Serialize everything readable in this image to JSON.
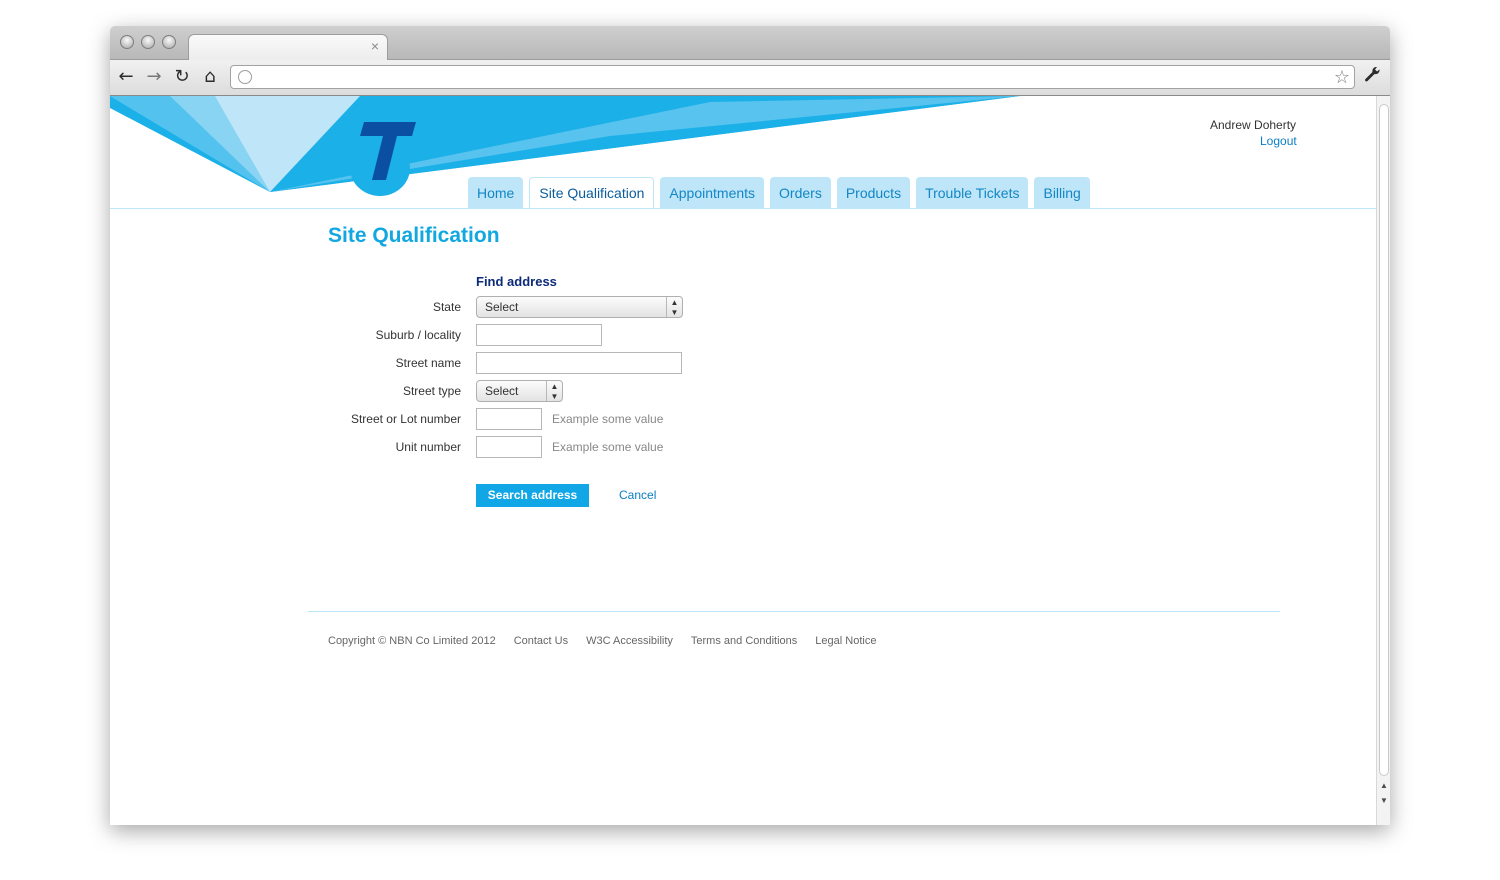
{
  "browser": {
    "tab_close": "×",
    "back_icon": "←",
    "forward_icon": "→",
    "reload_icon": "↻",
    "home_icon": "⌂",
    "star_icon": "☆",
    "wrench_icon": "🔧"
  },
  "header": {
    "user_name": "Andrew Doherty",
    "logout_label": "Logout",
    "brand_colors": {
      "primary": "#11a7e6",
      "light": "#bfe5f8",
      "logo": "#0a4fa1"
    }
  },
  "nav": {
    "tabs": [
      {
        "label": "Home",
        "active": false
      },
      {
        "label": "Site Qualification",
        "active": true
      },
      {
        "label": "Appointments",
        "active": false
      },
      {
        "label": "Orders",
        "active": false
      },
      {
        "label": "Products",
        "active": false
      },
      {
        "label": "Trouble Tickets",
        "active": false
      },
      {
        "label": "Billing",
        "active": false
      }
    ]
  },
  "main": {
    "title": "Site Qualification",
    "section_title": "Find address",
    "fields": {
      "state": {
        "label": "State",
        "value": "Select"
      },
      "suburb": {
        "label": "Suburb / locality",
        "value": ""
      },
      "street_name": {
        "label": "Street name",
        "value": ""
      },
      "street_type": {
        "label": "Street type",
        "value": "Select"
      },
      "street_number": {
        "label": "Street or Lot number",
        "value": "",
        "hint": "Example some value"
      },
      "unit_number": {
        "label": "Unit number",
        "value": "",
        "hint": "Example some value"
      }
    },
    "search_button": "Search address",
    "cancel_link": "Cancel"
  },
  "footer": {
    "copyright": "Copyright © NBN Co Limited 2012",
    "links": [
      "Contact Us",
      "W3C Accessibility",
      "Terms and Conditions",
      "Legal Notice"
    ]
  }
}
